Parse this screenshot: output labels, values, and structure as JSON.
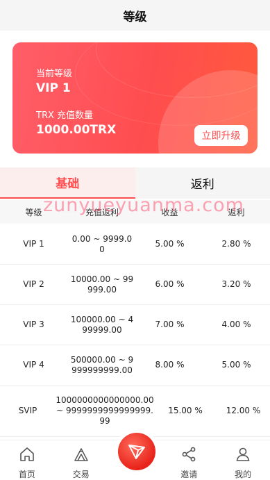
{
  "header": {
    "title": "等级"
  },
  "card": {
    "current_level_label": "当前等级",
    "current_level": "VIP 1",
    "recharge_label": "TRX 充值数量",
    "recharge_amount": "1000.00TRX",
    "upgrade_button": "立即升级"
  },
  "tabs": [
    {
      "label": "基础",
      "active": true
    },
    {
      "label": "返利",
      "active": false
    }
  ],
  "table": {
    "headers": [
      "等级",
      "充值返利",
      "收益",
      "返利"
    ],
    "rows": [
      {
        "level": "VIP 1",
        "range": "0.00 ~ 9999.00",
        "income": "5.00 %",
        "rebate": "2.80 %"
      },
      {
        "level": "VIP 2",
        "range": "10000.00 ~ 99999.00",
        "income": "6.00 %",
        "rebate": "3.20 %"
      },
      {
        "level": "VIP 3",
        "range": "100000.00 ~ 499999.00",
        "income": "7.00 %",
        "rebate": "4.00 %"
      },
      {
        "level": "VIP 4",
        "range": "500000.00 ~ 9999999999.00",
        "income": "8.00 %",
        "rebate": "5.00 %"
      },
      {
        "level": "SVIP",
        "range": "1000000000000000.00 ~ 9999999999999999.99",
        "income": "15.00 %",
        "rebate": "12.00 %"
      }
    ]
  },
  "watermark": "zunyueyuanma.com",
  "nav": {
    "items": [
      {
        "label": "首页",
        "icon": "home-icon"
      },
      {
        "label": "交易",
        "icon": "trade-icon"
      },
      {
        "label": "",
        "icon": "tron-logo-icon"
      },
      {
        "label": "邀请",
        "icon": "share-icon"
      },
      {
        "label": "我的",
        "icon": "user-icon"
      }
    ]
  },
  "colors": {
    "accent": "#ff4d4f",
    "tab_active_bg": "#fdeeee",
    "watermark": "#ff5a78"
  }
}
